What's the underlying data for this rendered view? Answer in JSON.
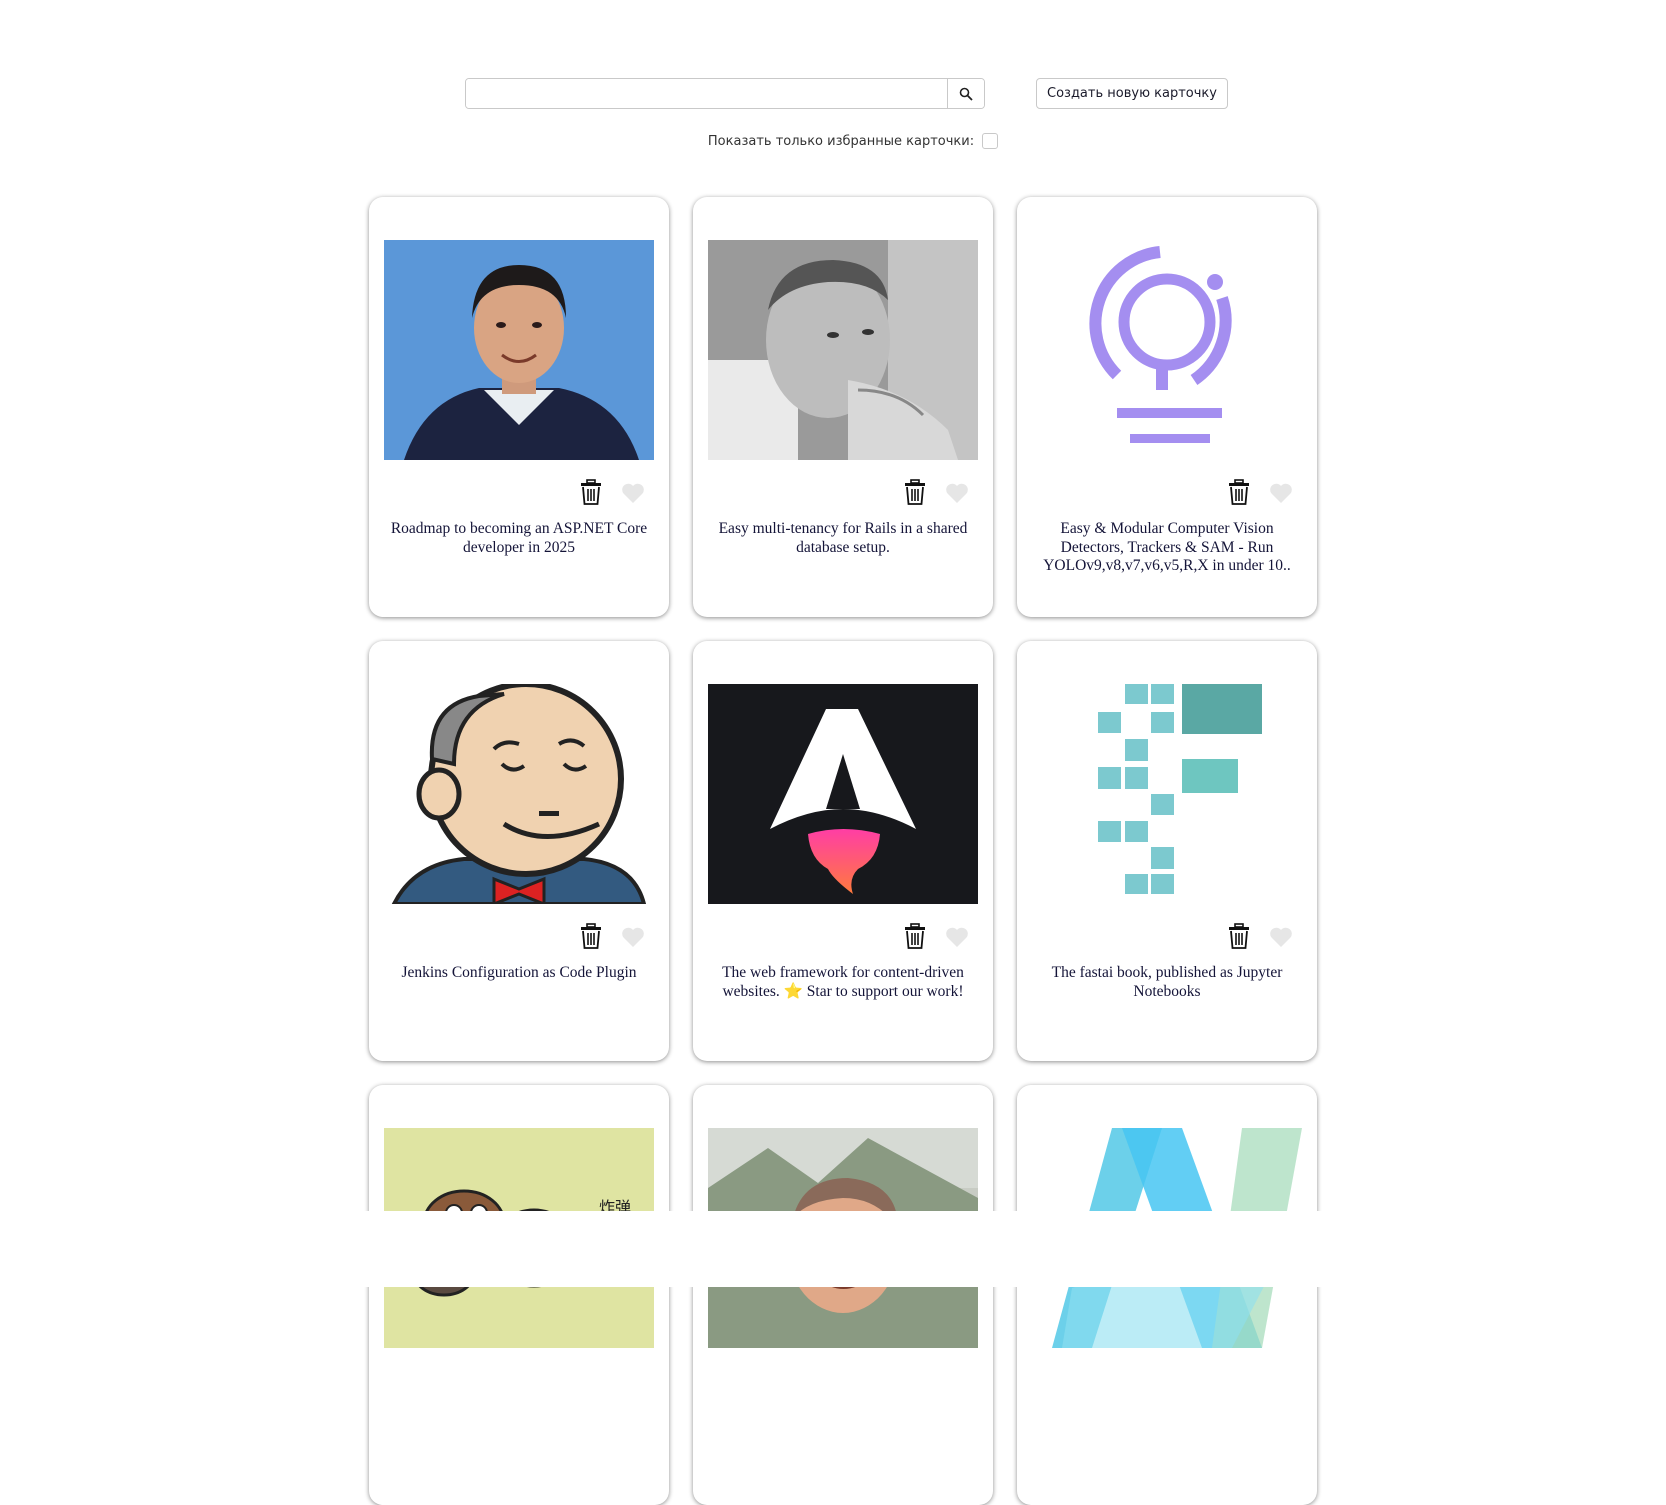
{
  "search": {
    "placeholder": ""
  },
  "create_button_label": "Создать новую карточку",
  "favorites_filter_label": "Показать только избранные карточки:",
  "icons": {
    "search": "search-icon",
    "delete": "trash-icon",
    "favorite": "heart-icon"
  },
  "colors": {
    "heart_inactive": "#e6e6e6",
    "title_text": "#141438"
  },
  "cards": [
    {
      "title": "Roadmap to becoming an ASP.NET Core developer in 2025",
      "image": "portrait-man-blue-background"
    },
    {
      "title": "Easy multi-tenancy for Rails in a shared database setup.",
      "image": "portrait-man-grayscale"
    },
    {
      "title": "Easy & Modular Computer Vision Detectors, Trackers & SAM - Run YOLOv9,v8,v7,v6,v5,R,X in under 10..",
      "image": "purple-lightbulb-logo"
    },
    {
      "title": "Jenkins Configuration as Code Plugin",
      "image": "jenkins-butler-logo"
    },
    {
      "title": "The web framework for content-driven websites. ⭐️ Star to support our work!",
      "image": "astro-rocket-logo"
    },
    {
      "title": "The fastai book, published as Jupyter Notebooks",
      "image": "fastai-pixel-logo"
    },
    {
      "title": "",
      "image": "cartoon-goblins-illustration"
    },
    {
      "title": "",
      "image": "portrait-man-mountains"
    },
    {
      "title": "",
      "image": "blue-green-angular-logo"
    }
  ]
}
